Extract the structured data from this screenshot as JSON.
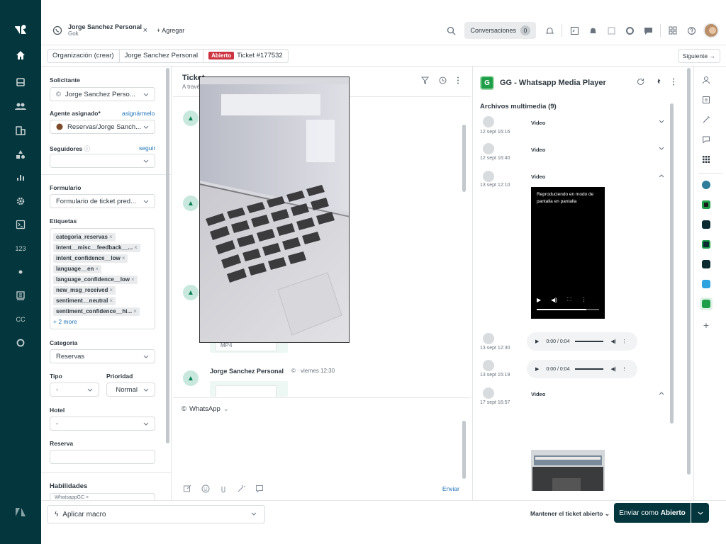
{
  "tab": {
    "title": "Jorge Sanchez Personal",
    "subtitle": "Gok",
    "close": "×"
  },
  "topbar": {
    "add_tab": "+ Agregar",
    "conversations_label": "Conversaciones",
    "conversations_count": "0"
  },
  "breadcrumb": {
    "org": "Organización (crear)",
    "requester": "Jorge Sanchez Personal",
    "status": "Abierto",
    "ticket": "Ticket #177532",
    "next": "Siguiente →"
  },
  "left": {
    "requester_label": "Solicitante",
    "requester_value": "Jorge Sanchez Perso...",
    "assignee_label": "Agente asignado*",
    "assign_me": "asignármelo",
    "assignee_value": "Reservas/Jorge Sanch...",
    "followers_label": "Seguidores",
    "follow": "seguir",
    "form_label": "Formulario",
    "form_value": "Formulario de ticket pred...",
    "tags_label": "Etiquetas",
    "tags": [
      "categoria_reservas",
      "intent__misc__feedback__...",
      "intent_confidence__low",
      "language__en",
      "language_confidence__low",
      "new_msg_received",
      "sentiment__neutral",
      "sentiment_confidence__hi..."
    ],
    "tags_more": "+ 2 more",
    "category_label": "Categoria",
    "category_value": "Reservas",
    "type_label": "Tipo",
    "type_value": "-",
    "priority_label": "Prioridad",
    "priority_value": "Normal",
    "hotel_label": "Hotel",
    "hotel_value": "-",
    "reservation_label": "Reserva",
    "reservation_value": "",
    "skills_label": "Habilidades",
    "skills_value": "WhatsappGC ×"
  },
  "conversation": {
    "title": "Ticket",
    "subtitle": "A travé",
    "attachment_type": "MP4",
    "author": "Jorge Sanchez Personal",
    "meta": "·  viernes 12:30",
    "channel": "WhatsApp",
    "send_link": "Enviar"
  },
  "app": {
    "title": "GG - Whatsapp Media Player",
    "media_header": "Archivos multimedia (9)",
    "items": [
      {
        "date": "12 sept 16:16",
        "label": "Video"
      },
      {
        "date": "12 sept 16:40",
        "label": "Video"
      },
      {
        "date": "13 sept 12:10",
        "label": "Video"
      },
      {
        "date": "13 sept 12:30",
        "label": ""
      },
      {
        "date": "13 sept 15:19",
        "label": ""
      },
      {
        "date": "17 sept 16:57",
        "label": "Video"
      }
    ],
    "pip_text": "Reproduciendo en modo de pantalla en pantalla",
    "audio_time": "0:00 / 0:04"
  },
  "nav": {
    "numbers_label": "123",
    "cc_label": "CC"
  },
  "footer": {
    "macro": "Aplicar macro",
    "keep_open": "Mantener el ticket abierto",
    "send_prefix": "Enviar como",
    "send_status": "Abierto"
  },
  "colors": {
    "nav_bg": "#03363d",
    "status_badge": "#cc3340",
    "link": "#1f73b7",
    "app_green": "#1e9e49"
  },
  "icons": [
    "home-icon",
    "views-icon",
    "users-icon",
    "org-icon",
    "reports-icon",
    "admin-icon",
    "terminal-icon",
    "search-icon",
    "bell-icon",
    "grid-icon",
    "help-icon",
    "whatsapp-icon",
    "filter-icon",
    "history-icon",
    "refresh-icon",
    "pin-icon",
    "more-icon",
    "play-icon",
    "volume-icon"
  ]
}
